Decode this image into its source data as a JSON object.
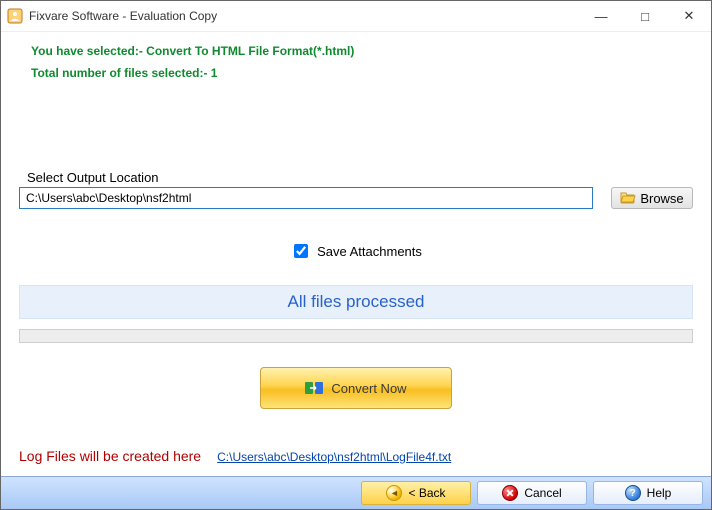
{
  "window": {
    "title": "Fixvare Software - Evaluation Copy"
  },
  "info": {
    "selection_line": "You have selected:- Convert To HTML File Format(*.html)",
    "count_line": "Total number of files selected:- 1"
  },
  "output": {
    "label": "Select Output Location",
    "path": "C:\\Users\\abc\\Desktop\\nsf2html",
    "browse_label": "Browse"
  },
  "options": {
    "save_attachments_label": "Save Attachments",
    "save_attachments_checked": true
  },
  "status": {
    "text": "All files processed"
  },
  "actions": {
    "convert_label": "Convert Now"
  },
  "log": {
    "label": "Log Files will be created here",
    "link": "C:\\Users\\abc\\Desktop\\nsf2html\\LogFile4f.txt"
  },
  "footer": {
    "back_label": "< Back",
    "cancel_label": "Cancel",
    "help_label": "Help"
  }
}
